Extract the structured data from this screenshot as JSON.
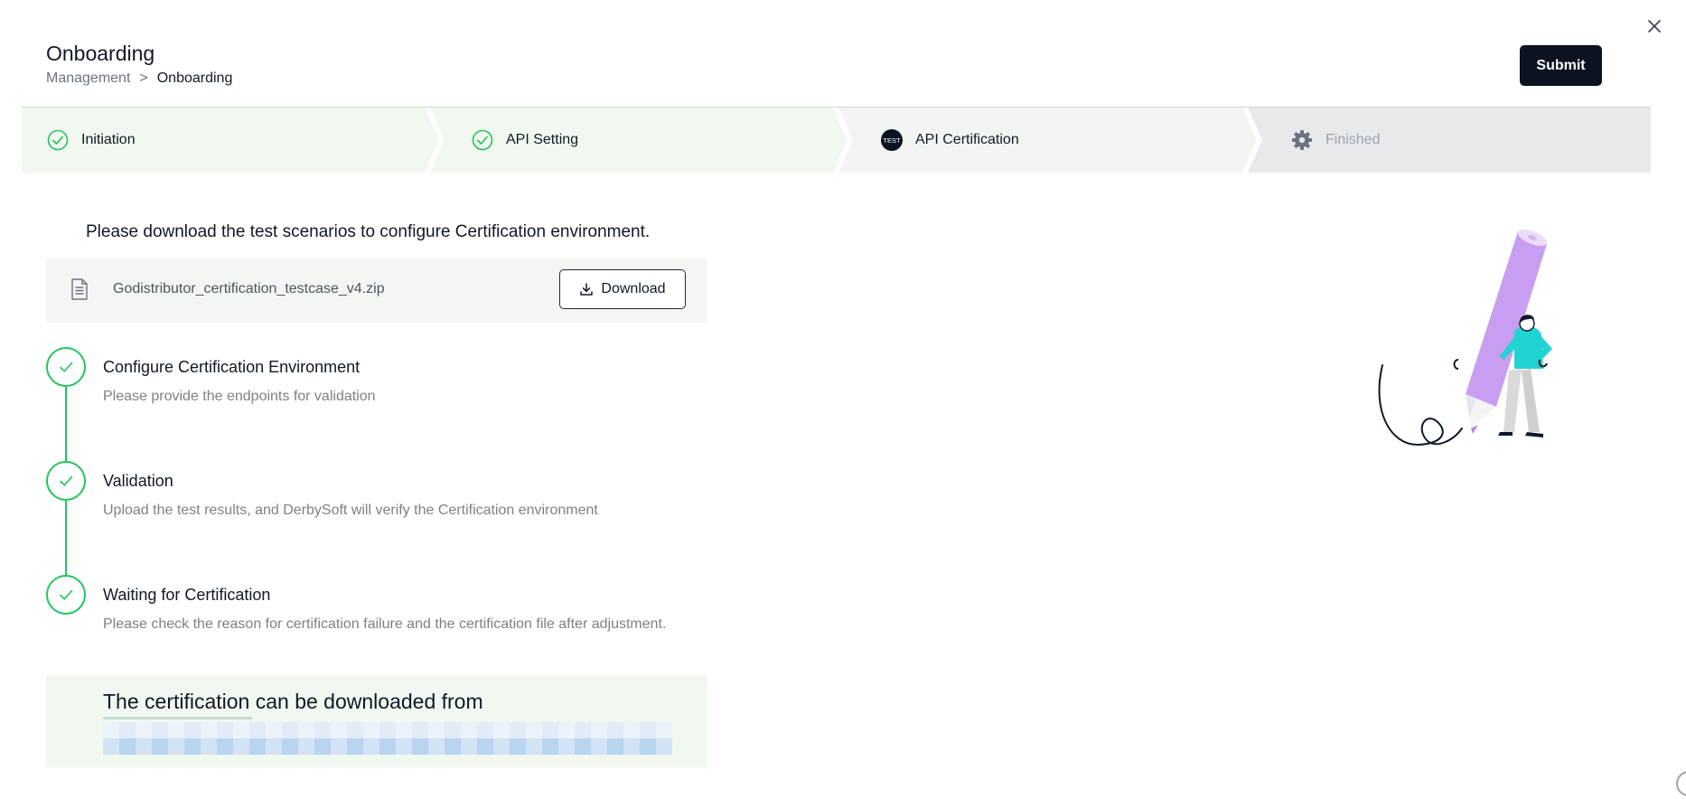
{
  "header": {
    "title": "Onboarding",
    "breadcrumb": {
      "parent": "Management",
      "separator": ">",
      "current": "Onboarding"
    },
    "submit_label": "Submit"
  },
  "steps": [
    {
      "label": "Initiation",
      "status": "done",
      "icon": "check-circle-icon"
    },
    {
      "label": "API Setting",
      "status": "done",
      "icon": "check-circle-icon"
    },
    {
      "label": "API Certification",
      "status": "active",
      "icon": "test-badge-icon",
      "icon_text": "TEST"
    },
    {
      "label": "Finished",
      "status": "pending",
      "icon": "gear-icon"
    }
  ],
  "main": {
    "intro": "Please download the test scenarios to configure Certification environment.",
    "file": {
      "name": "Godistributor_certification_testcase_v4.zip",
      "download_label": "Download"
    },
    "timeline": [
      {
        "title": "Configure Certification Environment",
        "description": "Please provide the endpoints for validation"
      },
      {
        "title": "Validation",
        "description": "Upload the test results, and DerbySoft will verify the Certification environment"
      },
      {
        "title": "Waiting for Certification",
        "description": "Please check the reason for certification failure and the certification file after adjustment."
      }
    ],
    "certification": {
      "title": "The certification can be downloaded from"
    }
  },
  "colors": {
    "accent": "#22c55e",
    "primary_button": "#0b1220",
    "step_done_bg": "#f1f8ef",
    "step_active_bg": "#f3f5f3",
    "step_pending_bg": "#e7e9eb",
    "pencil": "#c89ef2",
    "figure_shirt": "#22d3d3"
  }
}
